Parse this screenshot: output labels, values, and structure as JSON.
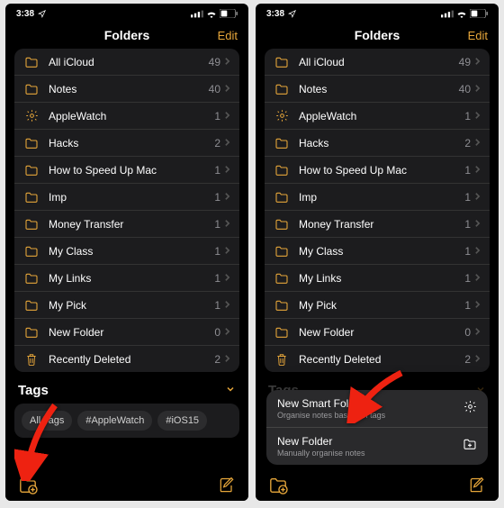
{
  "status": {
    "time": "3:38",
    "location_icon": "location",
    "signal": 3,
    "wifi": true,
    "battery": 40
  },
  "nav": {
    "title": "Folders",
    "edit": "Edit"
  },
  "folders": [
    {
      "icon": "folder",
      "name": "All iCloud",
      "count": 49
    },
    {
      "icon": "folder",
      "name": "Notes",
      "count": 40
    },
    {
      "icon": "gear",
      "name": "AppleWatch",
      "count": 1
    },
    {
      "icon": "folder",
      "name": "Hacks",
      "count": 2
    },
    {
      "icon": "folder",
      "name": "How to Speed Up Mac",
      "count": 1
    },
    {
      "icon": "folder",
      "name": "Imp",
      "count": 1
    },
    {
      "icon": "folder",
      "name": "Money Transfer",
      "count": 1
    },
    {
      "icon": "folder",
      "name": "My Class",
      "count": 1
    },
    {
      "icon": "folder",
      "name": "My Links",
      "count": 1
    },
    {
      "icon": "folder",
      "name": "My Pick",
      "count": 1
    },
    {
      "icon": "folder",
      "name": "New Folder",
      "count": 0
    },
    {
      "icon": "trash",
      "name": "Recently Deleted",
      "count": 2
    }
  ],
  "tags_section": {
    "title": "Tags"
  },
  "tags": [
    "All Tags",
    "#AppleWatch",
    "#iOS15"
  ],
  "toolbar": {
    "new_folder_icon": "new-folder",
    "compose_icon": "compose"
  },
  "menu": {
    "items": [
      {
        "title": "New Smart Folder",
        "subtitle": "Organise notes based on tags",
        "icon": "gear"
      },
      {
        "title": "New Folder",
        "subtitle": "Manually organise notes",
        "icon": "folder-plus"
      }
    ]
  },
  "colors": {
    "accent": "#e6a63a"
  }
}
